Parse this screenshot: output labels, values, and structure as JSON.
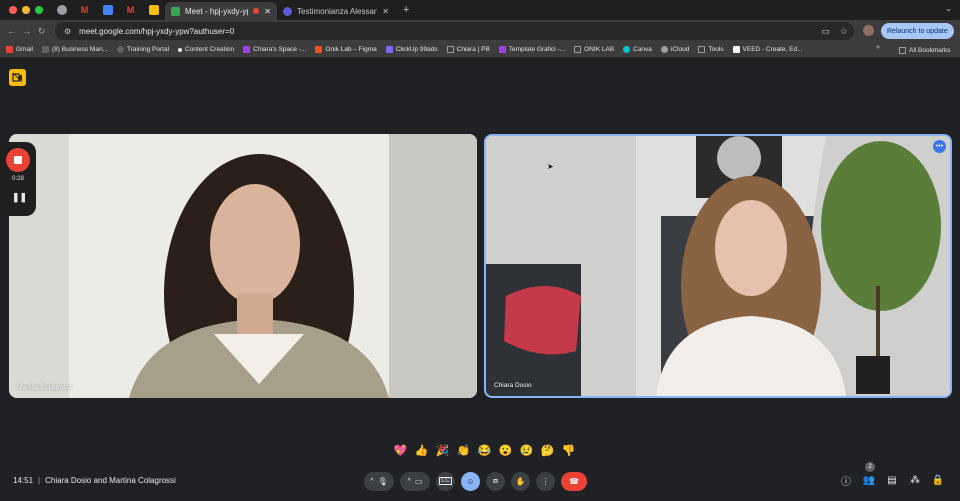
{
  "browser": {
    "traffic_colors": [
      "#ff5f57",
      "#febc2e",
      "#28c840"
    ],
    "pinned_tabs": [
      {
        "name": "chrome-tab",
        "color": "#9aa0a6"
      },
      {
        "name": "gmail-tab",
        "color": "#ea4335",
        "glyph": "M"
      },
      {
        "name": "calendar-tab",
        "color": "#4285f4"
      },
      {
        "name": "gmail-tab-2",
        "color": "#ea4335",
        "glyph": "M"
      },
      {
        "name": "keep-tab",
        "color": "#fbbc04"
      }
    ],
    "tabs": [
      {
        "title": "Meet - hpj-yxdy-ypw",
        "active": true
      },
      {
        "title": "Testimonianza Alessandra",
        "active": false
      }
    ],
    "new_tab": "+",
    "url": "meet.google.com/hpj-yxdy-ypw?authuser=0",
    "relaunch_label": "Relaunch to update",
    "bookmarks": [
      {
        "label": "Gmail",
        "color": "#ea4335"
      },
      {
        "label": "(8) Business Man...",
        "color": "#5f6368"
      },
      {
        "label": "Training Portal",
        "color": "#5f6368"
      },
      {
        "label": "Content Creation",
        "color": "#e8eaed"
      },
      {
        "label": "Chiara's Space -...",
        "color": "#a142f4"
      },
      {
        "label": "Onik Lab – Figma",
        "color": "#f24e1e"
      },
      {
        "label": "ClickUp 99ads",
        "color": "#7b68ee"
      },
      {
        "label": "Chiara | PB",
        "color": "#9aa0a6"
      },
      {
        "label": "Template Grafici -...",
        "color": "#a142f4"
      },
      {
        "label": "ONIK LAB",
        "color": "#9aa0a6"
      },
      {
        "label": "Canva",
        "color": "#00c4cc"
      },
      {
        "label": "iCloud",
        "color": "#9aa0a6"
      },
      {
        "label": "Tools",
        "color": "#9aa0a6"
      },
      {
        "label": "VEED - Create, Ed...",
        "color": "#ffffff"
      }
    ],
    "bookmarks_more": "»",
    "all_bookmarks": "All Bookmarks"
  },
  "meet": {
    "recording_time": "0:28",
    "participants": [
      {
        "name": "Martina Colagrossi"
      },
      {
        "name": "Chiara Dosio"
      }
    ],
    "tile_menu": "•••",
    "reactions": [
      "💖",
      "👍",
      "🎉",
      "👏",
      "😂",
      "😮",
      "😢",
      "🤔",
      "👎"
    ],
    "time": "14:51",
    "separator": "|",
    "meeting_title": "Chiara Dosio and Martina Colagrossi",
    "people_count": "2",
    "accent": "#8ab4f8",
    "hangup_color": "#ea4335"
  }
}
